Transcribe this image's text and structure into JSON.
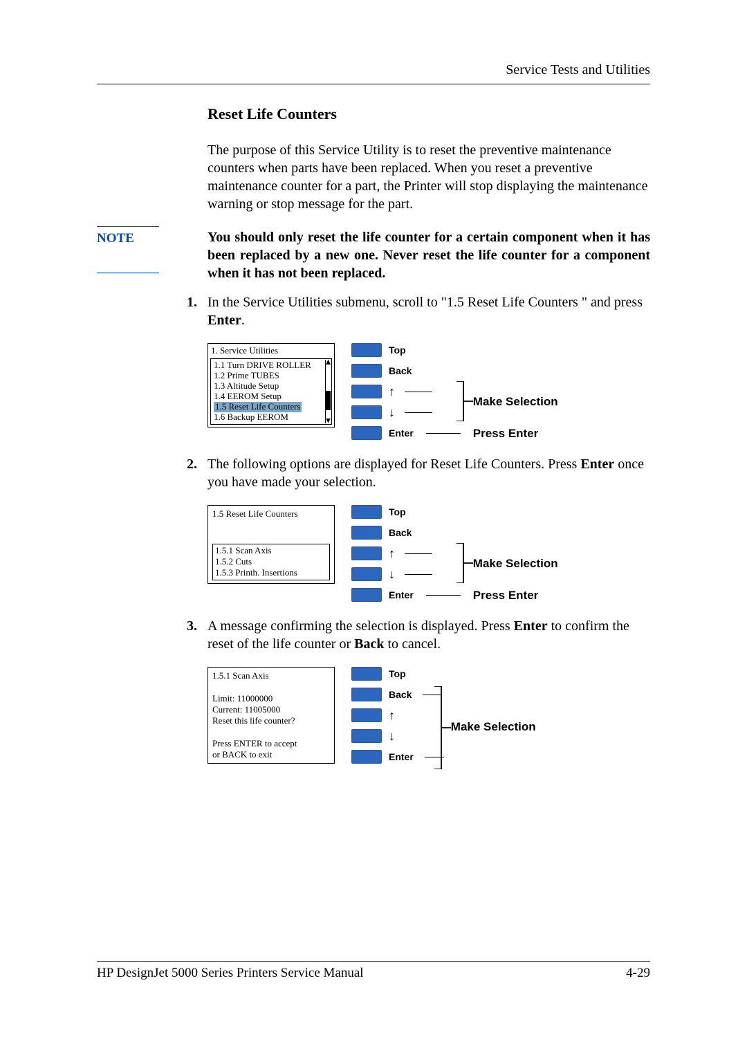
{
  "header": {
    "running": "Service Tests and Utilities"
  },
  "section": {
    "title": "Reset Life Counters",
    "intro": "The purpose of this Service Utility is to reset the preventive maintenance counters when parts have been replaced. When you reset a preventive maintenance counter for a part, the Printer will stop displaying the maintenance warning or stop message for the part."
  },
  "note": {
    "label": "NOTE",
    "text": "You should only reset the life counter for a certain component when it has been replaced by a new one. Never reset the life counter for a component when it has not been replaced."
  },
  "steps": {
    "s1_a": "In the Service Utilities submenu, scroll to \"1.5 Reset Life Counters \" and press ",
    "s1_b": "Enter",
    "s1_c": ".",
    "s2_a": "The following options are displayed for Reset Life Counters. Press ",
    "s2_b": "Enter",
    "s2_c": " once you have made your selection.",
    "s3_a": "A message confirming the selection is displayed. Press ",
    "s3_b": "Enter",
    "s3_c": " to confirm the reset of the life counter or ",
    "s3_d": "Back",
    "s3_e": " to cancel."
  },
  "lcd1": {
    "title": "1. Service Utilities",
    "rows": [
      "1.1 Turn DRIVE ROLLER",
      "1.2 Prime TUBES",
      "1.3 Altitude Setup",
      "1.4 EEROM Setup",
      "1.5 Reset Life Counters",
      "1.6 Backup EEROM"
    ],
    "hl_index": 4
  },
  "lcd2": {
    "title": "1.5 Reset Life Counters",
    "rows": [
      "",
      "",
      "1.5.1 Scan Axis",
      "1.5.2 Cuts",
      "1.5.3 Printh. Insertions"
    ],
    "hl_index": 2
  },
  "lcd3": {
    "rows": [
      "1.5.1 Scan Axis",
      "",
      "Limit: 11000000",
      "Current: 11005000",
      "Reset this life counter?",
      "",
      "Press ENTER to accept",
      "or BACK to exit"
    ]
  },
  "buttons": {
    "top": "Top",
    "back": "Back",
    "up": "↑",
    "down": "↓",
    "enter": "Enter"
  },
  "callouts": {
    "make": "Make Selection",
    "press": "Press Enter"
  },
  "footer": {
    "left": "HP DesignJet 5000 Series Printers Service Manual",
    "right": "4-29"
  }
}
